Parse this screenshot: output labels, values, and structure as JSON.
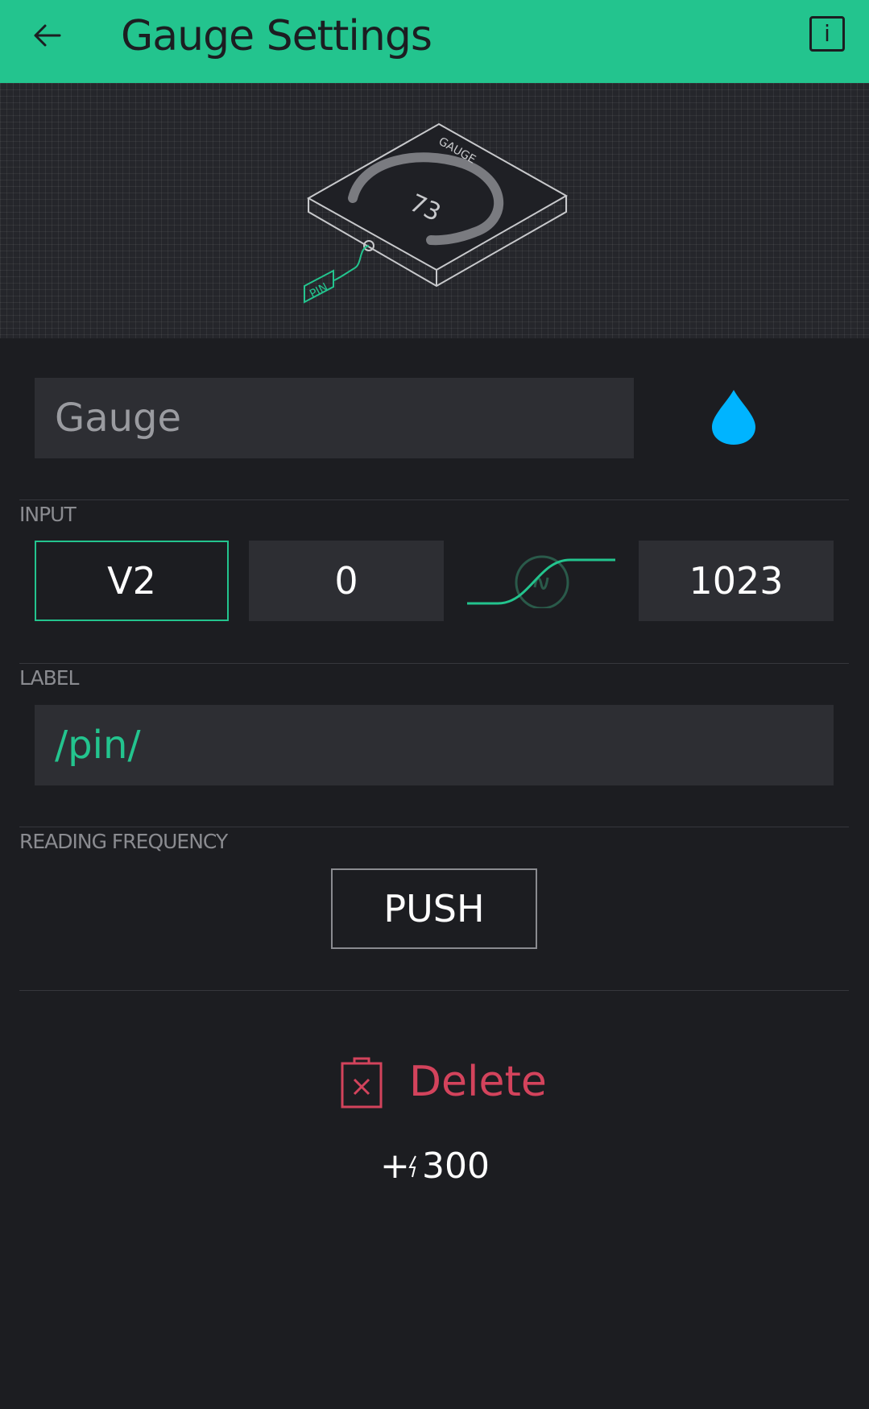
{
  "header": {
    "title": "Gauge Settings",
    "back_icon": "arrow-left-icon",
    "info_label": "i",
    "background": "#23c48e"
  },
  "preview": {
    "gauge_label": "GAUGE",
    "gauge_value": "73",
    "pin_label": "PIN"
  },
  "widget": {
    "name_value": "Gauge",
    "color_icon": "droplet-icon",
    "color": "#00b4ff"
  },
  "input": {
    "section_label": "INPUT",
    "pin": "V2",
    "min": "0",
    "max": "1023",
    "mapping_icon": "curve-mapping-icon"
  },
  "label": {
    "section_label": "LABEL",
    "value": "/pin/"
  },
  "reading_frequency": {
    "section_label": "READING FREQUENCY",
    "value": "PUSH"
  },
  "actions": {
    "delete_label": "Delete",
    "delete_icon": "trash-icon",
    "delete_color": "#d3435c",
    "cost_prefix": "+",
    "cost_icon": "energy-bolt-icon",
    "cost_amount": "300"
  }
}
